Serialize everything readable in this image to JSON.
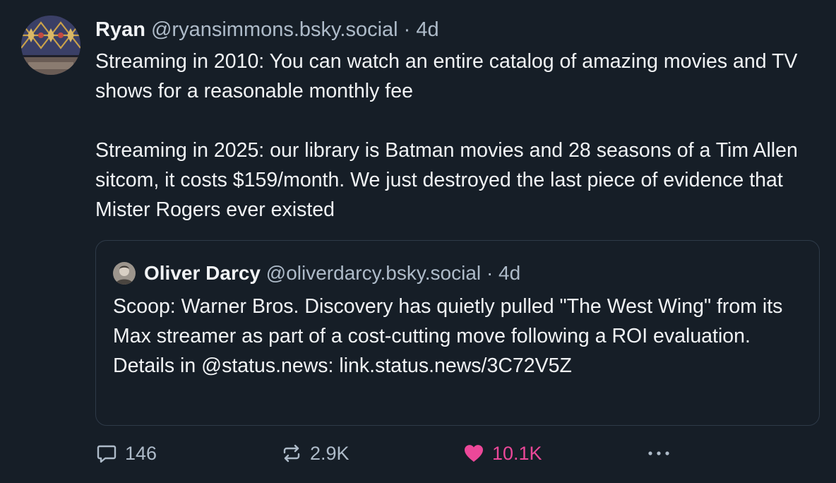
{
  "post": {
    "author_name": "Ryan",
    "author_handle": "@ryansimmons.bsky.social",
    "separator": "·",
    "time": "4d",
    "paragraph_1": "Streaming in 2010: You can watch an entire catalog of amazing movies and TV shows for a reasonable monthly fee",
    "paragraph_2": "Streaming in 2025: our library is Batman movies and 28 seasons of a Tim Allen sitcom, it costs $159/month. We just destroyed the last piece of evidence that Mister Rogers ever existed"
  },
  "quote": {
    "author_name": "Oliver Darcy",
    "author_handle": "@oliverdarcy.bsky.social",
    "separator": "·",
    "time": "4d",
    "text": "Scoop: Warner Bros. Discovery has quietly pulled \"The West Wing\" from its Max streamer as part of a cost-cutting move following a ROI evaluation. Details in @status.news: link.status.news/3C72V5Z"
  },
  "actions": {
    "reply_count": "146",
    "repost_count": "2.9K",
    "like_count": "10.1K",
    "reply_icon": "speech-bubble-icon",
    "repost_icon": "repost-arrows-icon",
    "like_icon": "heart-icon",
    "more_icon": "ellipsis-icon",
    "like_color": "#ec4899"
  },
  "colors": {
    "background": "#161e27",
    "text": "#f1f3f5",
    "muted": "#aebbc9",
    "border": "#2e3a48"
  }
}
